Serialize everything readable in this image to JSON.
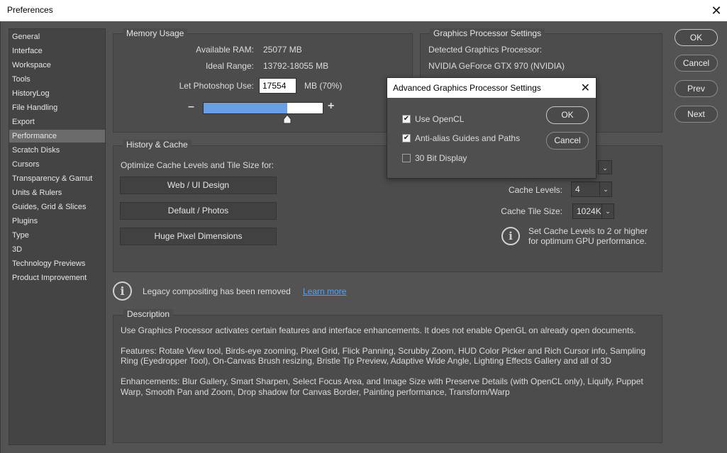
{
  "window": {
    "title": "Preferences",
    "close_glyph": "✕"
  },
  "sidebar": {
    "items": [
      {
        "label": "General"
      },
      {
        "label": "Interface"
      },
      {
        "label": "Workspace"
      },
      {
        "label": "Tools"
      },
      {
        "label": "HistoryLog"
      },
      {
        "label": "File Handling"
      },
      {
        "label": "Export"
      },
      {
        "label": "Performance"
      },
      {
        "label": "Scratch Disks"
      },
      {
        "label": "Cursors"
      },
      {
        "label": "Transparency & Gamut"
      },
      {
        "label": "Units & Rulers"
      },
      {
        "label": "Guides, Grid & Slices"
      },
      {
        "label": "Plugins"
      },
      {
        "label": "Type"
      },
      {
        "label": "3D"
      },
      {
        "label": "Technology Previews"
      },
      {
        "label": "Product Improvement"
      }
    ],
    "selected": "Performance"
  },
  "memory": {
    "title": "Memory Usage",
    "available_label": "Available RAM:",
    "available_value": "25077 MB",
    "ideal_label": "Ideal Range:",
    "ideal_value": "13792-18055 MB",
    "use_label": "Let Photoshop Use:",
    "use_value": "17554",
    "use_suffix": "MB (70%)",
    "minus": "–",
    "plus": "+",
    "slider_fraction": 0.7
  },
  "gpu": {
    "title": "Graphics Processor Settings",
    "detected_label": "Detected Graphics Processor:",
    "detected_value": "NVIDIA GeForce GTX 970 (NVIDIA)"
  },
  "history": {
    "title": "History & Cache",
    "optimize_label": "Optimize Cache Levels and Tile Size for:",
    "buttons": [
      "Web / UI Design",
      "Default / Photos",
      "Huge Pixel Dimensions"
    ],
    "cache_levels_label": "Cache Levels:",
    "cache_levels_value": "4",
    "tile_size_label": "Cache Tile Size:",
    "tile_size_value": "1024K",
    "info_line1": "Set Cache Levels to 2 or higher",
    "info_line2": "for optimum GPU performance."
  },
  "legacy": {
    "text": "Legacy compositing has been removed",
    "link": "Learn more"
  },
  "description": {
    "title": "Description",
    "p1": "Use Graphics Processor activates certain features and interface enhancements. It does not enable OpenGL on already open documents.",
    "p2a": "Features: Rotate View tool, Birds-eye zooming, Pixel Grid, Flick Panning, Scrubby Zoom, HUD Color Picker and Rich Cursor info, Sampling",
    "p2b": "Ring (Eyedropper Tool), On-Canvas Brush resizing, Bristle Tip Preview, Adaptive Wide Angle, Lighting Effects Gallery and all of 3D",
    "p3a": "Enhancements: Blur Gallery, Smart Sharpen, Select Focus Area, and Image Size with Preserve Details (with OpenCL only), Liquify, Puppet",
    "p3b": "Warp, Smooth Pan and Zoom, Drop shadow for Canvas Border, Painting performance, Transform/Warp"
  },
  "actions": {
    "ok": "OK",
    "cancel": "Cancel",
    "prev": "Prev",
    "next": "Next"
  },
  "dialog": {
    "title": "Advanced Graphics Processor Settings",
    "close_glyph": "✕",
    "options": [
      {
        "label": "Use OpenCL",
        "checked": true
      },
      {
        "label": "Anti-alias Guides and Paths",
        "checked": true
      },
      {
        "label": "30 Bit Display",
        "checked": false
      }
    ],
    "ok": "OK",
    "cancel": "Cancel"
  },
  "colors": {
    "panel": "#535353",
    "slider_fill": "#6a9fe8",
    "link": "#4da3ff"
  }
}
